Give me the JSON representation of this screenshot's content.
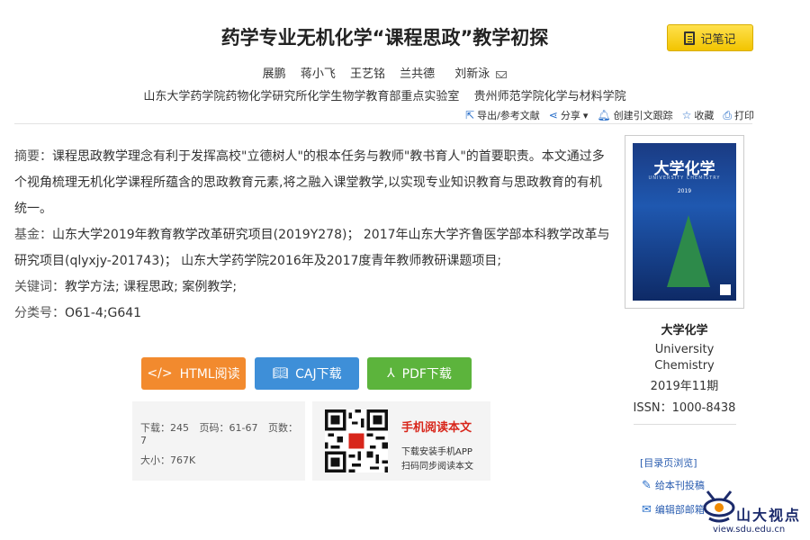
{
  "article": {
    "title": "药学专业无机化学“课程思政”教学初探",
    "authors": [
      "展鹏",
      "蒋小飞",
      "王艺铭",
      "兰共德",
      "刘新泳"
    ],
    "institutions": [
      "山东大学药学院药物化学研究所化学生物学教育部重点实验室",
      "贵州师范学院化学与材料学院"
    ]
  },
  "toolbar": {
    "note_button": "记笔记",
    "export": "导出/参考文献",
    "share": "分享",
    "follow": "创建引文跟踪",
    "favorite": "收藏",
    "print": "打印"
  },
  "abstract": {
    "label": "摘要：",
    "text": "课程思政教学理念有利于发挥高校\"立德树人\"的根本任务与教师\"教书育人\"的首要职责。本文通过多个视角梳理无机化学课程所蕴含的思政教育元素,将之融入课堂教学,以实现专业知识教育与思政教育的有机统一。"
  },
  "fund": {
    "label": "基金：",
    "text": "山东大学2019年教育教学改革研究项目(2019Y278)； 2017年山东大学齐鲁医学部本科教学改革与研究项目(qlyxjy-201743)； 山东大学药学院2016年及2017度青年教师教研课题项目;"
  },
  "keywords": {
    "label": "关键词：",
    "text": "教学方法; 课程思政; 案例教学;"
  },
  "classification": {
    "label": "分类号：",
    "text": "O61-4;G641"
  },
  "downloads": {
    "html": "HTML阅读",
    "caj": "CAJ下载",
    "pdf": "PDF下载"
  },
  "stats": {
    "downloads": "下载：245",
    "pages": "页码：61-67",
    "page_count": "页数：7",
    "size": "大小：767K"
  },
  "mobile": {
    "title": "手机阅读本文",
    "line1": "下载安装手机APP",
    "line2": "扫码同步阅读本文"
  },
  "journal": {
    "cover_title": "大学化学",
    "cover_subtitle": "UNIVERSITY CHEMISTRY",
    "cover_year": "2019",
    "name": "大学化学",
    "english_name": "University Chemistry",
    "date": "2019年11期",
    "issn": "ISSN：1000-8438",
    "toc_link": "[目录页浏览]",
    "submit": "给本刊投稿",
    "editorial": "编辑部邮箱"
  },
  "watermark": {
    "text": "山大视点",
    "url": "view.sdu.edu.cn"
  },
  "colors": {
    "note_button": "#f2c400",
    "html_button": "#f28a2e",
    "caj_button": "#3e8fd8",
    "pdf_button": "#5cb43c",
    "mobile_title": "#d8261b",
    "link": "#2a5db0"
  }
}
